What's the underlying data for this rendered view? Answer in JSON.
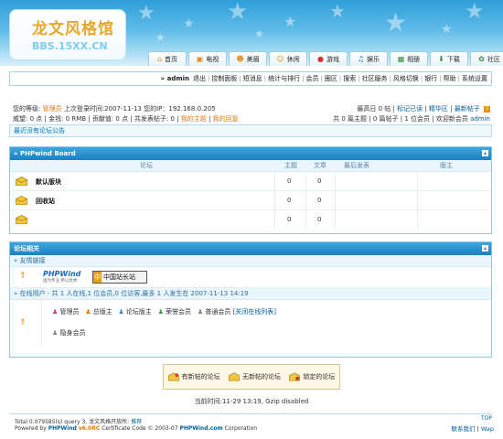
{
  "logo": {
    "title": "龙文风格馆",
    "subtitle": "BBS.15XX.CN"
  },
  "nav_tabs": [
    {
      "label": "首页",
      "icon": "home-icon"
    },
    {
      "label": "电视",
      "icon": "tv-icon"
    },
    {
      "label": "美眉",
      "icon": "girl-icon"
    },
    {
      "label": "休闲",
      "icon": "leisure-icon"
    },
    {
      "label": "游戏",
      "icon": "game-icon"
    },
    {
      "label": "娱乐",
      "icon": "entertainment-icon"
    },
    {
      "label": "相册",
      "icon": "album-icon"
    },
    {
      "label": "下载",
      "icon": "download-icon"
    },
    {
      "label": "社区",
      "icon": "community-icon"
    }
  ],
  "userbar": {
    "username": "» admin",
    "links": [
      "退出",
      "控制面板",
      "短消息",
      "统计与排行",
      "会员",
      "圈区",
      "搜索",
      "社区服务",
      "风格切换",
      "银行",
      "帮助",
      "系统设置"
    ]
  },
  "info": {
    "level_label": "您的等级:",
    "level_value": "管理员",
    "last_login": "上次登录时间:2007-11-13",
    "ip": "您的IP：192.168.0.205",
    "stats_line": "威望: 0 点 | 金钱: 0 RMB | 贡献值: 0 点 | 共发表帖子: 0 |",
    "my_topics": "我的主题",
    "my_replies": "我的回复",
    "right_top": "最高日 0 帖 |",
    "mark_read": "标记已读",
    "sep1": "|",
    "elite": "精华区",
    "sep2": "|",
    "newest": "最新帖子",
    "right_bottom": "共 0 篇主题 | 0 篇帖子 | 1 位会员 | 欢迎新会员",
    "new_member": "admin"
  },
  "notice": "最近没有论坛公告",
  "board": {
    "title": "» PHPwind Board",
    "columns": {
      "forum": "论坛",
      "topics": "主题",
      "posts": "文章",
      "last_post": "最后发表",
      "moderator": "版主"
    },
    "rows": [
      {
        "name": "默认版块",
        "topics": "0",
        "posts": "0"
      },
      {
        "name": "回收站",
        "topics": "0",
        "posts": "0"
      },
      {
        "name": "",
        "topics": "0",
        "posts": "0"
      }
    ]
  },
  "related": {
    "title": "论坛相关",
    "friend_links": "» 友情链接",
    "phpwind_logo": "PHPWind",
    "phpwind_slogan": "国为专业 所以优秀",
    "china_site": "中国站长站",
    "online_line": "» 在线用户 - 共 1 人在线,1 位会员,0 位访客,最多 1 人发生在 2007-11-13 14:19",
    "roles": [
      "管理员",
      "总版主",
      "论坛版主",
      "荣誉会员",
      "普通会员"
    ],
    "close_list": "[关闭在线列表]",
    "hidden": "隐身会员"
  },
  "legend": {
    "new": "有新帖的论坛",
    "no_new": "无新帖的论坛",
    "locked": "锁定的论坛"
  },
  "current_time": "当前时间:11-29 13:19, Gzip disabled",
  "footer": {
    "line1_a": "Total 0.079585(s) query 3, 龙文风格开放所:",
    "line1_link": "推荐",
    "line2_a": "Powered by",
    "line2_brand": "PHPWind",
    "line2_ver": "v6.0RC",
    "line2_b": "Certificate Code © 2003-07",
    "line2_site": "PHPWind.com",
    "line2_c": "Corporation",
    "top": "TOP",
    "contact": "联系我们",
    "wap": "Wap"
  },
  "colors": {
    "header_blue": "#2f9ed8",
    "panel_blue": "#1d7fc0",
    "admin_orange": "#e07a00",
    "link_blue": "#0060a0"
  }
}
